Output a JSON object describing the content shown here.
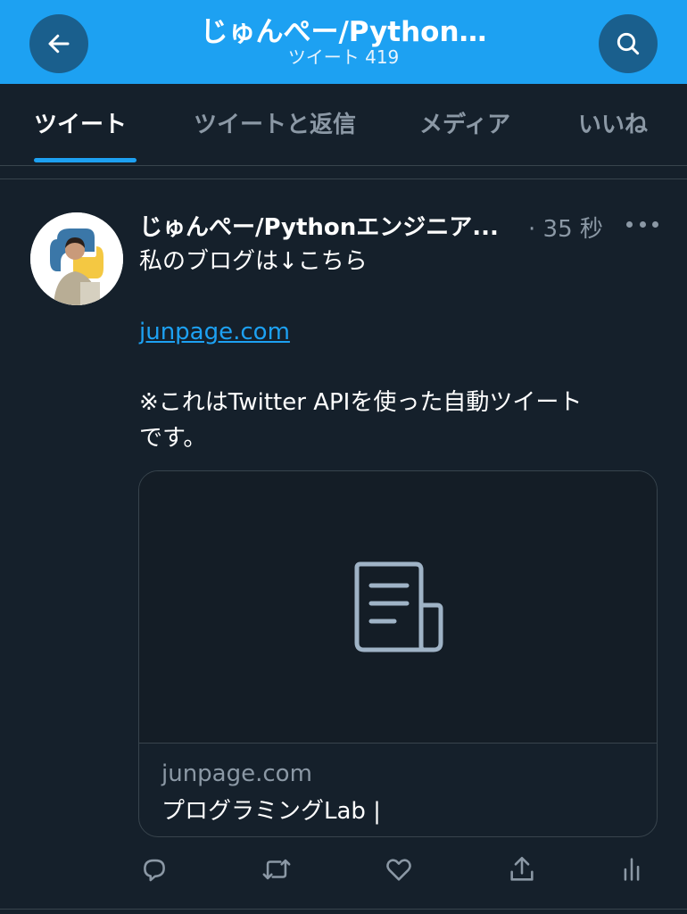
{
  "header": {
    "title": "じゅんぺー/Python…",
    "subtitle": "ツイート 419",
    "back_icon": "arrow-left-icon",
    "search_icon": "search-icon"
  },
  "tabs": [
    {
      "label": "ツイート",
      "active": true
    },
    {
      "label": "ツイートと返信",
      "active": false
    },
    {
      "label": "メディア",
      "active": false
    },
    {
      "label": "いいね",
      "active": false
    }
  ],
  "tweet": {
    "author_name": "じゅんぺー/Pythonエンジニア...",
    "time": "· 35 秒",
    "line1": "私のブログは↓こちら",
    "link": "junpage.com",
    "line3": "※これはTwitter APIを使った自動ツイート",
    "line4": "です。",
    "card": {
      "domain": "junpage.com",
      "title": "プログラミングLab |"
    }
  },
  "actions": [
    "reply-icon",
    "retweet-icon",
    "like-icon",
    "share-icon",
    "analytics-icon"
  ],
  "colors": {
    "accent": "#1da1f2",
    "background": "#15202b",
    "secondary_text": "#8b98a5",
    "border": "#38444d"
  }
}
